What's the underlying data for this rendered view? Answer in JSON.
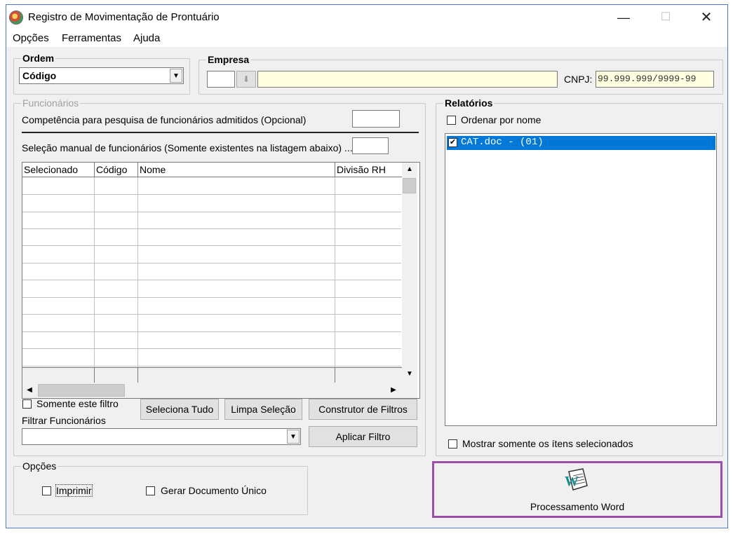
{
  "window": {
    "title": "Registro de Movimentação de Prontuário",
    "controls": {
      "minimize": "—",
      "maximize": "☐",
      "close": "✕"
    }
  },
  "menu": [
    "Opções",
    "Ferramentas",
    "Ajuda"
  ],
  "ordem": {
    "legend": "Ordem",
    "value": "Código"
  },
  "empresa": {
    "legend": "Empresa",
    "code_value": "",
    "name_value": "",
    "cnpj_label": "CNPJ:",
    "cnpj_value": "99.999.999/9999-99"
  },
  "funcionarios": {
    "legend": "Funcionários",
    "competencia_label": "Competência para pesquisa de funcionários admitidos (Opcional)",
    "competencia_value": "",
    "selecao_label": "Seleção manual de funcionários (Somente existentes na listagem abaixo) ...",
    "selecao_value": "",
    "columns": [
      "Selecionado",
      "Código",
      "Nome",
      "Divisão RH"
    ],
    "somente_filtro_label": "Somente este filtro",
    "somente_filtro_checked": false,
    "filtrar_label": "Filtrar Funcionários",
    "filtrar_value": "",
    "buttons": {
      "seleciona_tudo": "Seleciona Tudo",
      "limpa_selecao": "Limpa Seleção",
      "construtor_filtros": "Construtor de Filtros",
      "aplicar_filtro": "Aplicar Filtro"
    }
  },
  "relatorios": {
    "legend": "Relatórios",
    "ordenar_label": "Ordenar por nome",
    "ordenar_checked": false,
    "items": [
      {
        "label": "CAT.doc - (01)",
        "checked": true
      }
    ],
    "mostrar_label": "Mostrar somente os ítens selecionados",
    "mostrar_checked": false
  },
  "opcoes": {
    "legend": "Opções",
    "imprimir_label": "Imprimir",
    "imprimir_checked": false,
    "gerar_label": "Gerar Documento Único",
    "gerar_checked": false
  },
  "process_button": {
    "label": "Processamento Word",
    "icon": "word-document-icon",
    "highlight_color": "#9b4fa6"
  },
  "colors": {
    "selection": "#0078d7",
    "yellow_field": "#ffffe1",
    "window_border": "#4a7bd0"
  }
}
